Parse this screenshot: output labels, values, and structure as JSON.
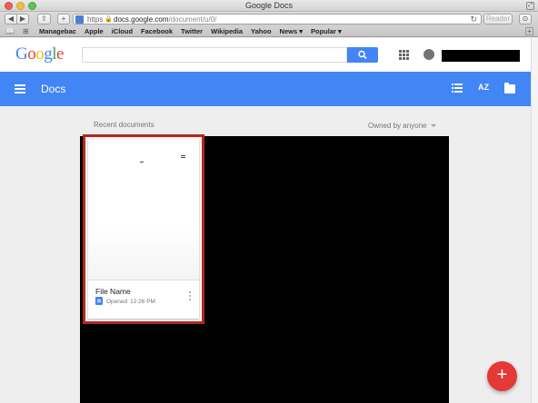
{
  "window": {
    "title": "Google Docs"
  },
  "browser": {
    "url_scheme": "https",
    "url_host": "docs.google.com",
    "url_path": "/document/u/0/",
    "reader_label": "Reader"
  },
  "bookmarks": [
    "Managebac",
    "Apple",
    "iCloud",
    "Facebook",
    "Twitter",
    "Wikipedia",
    "Yahoo",
    "News ▾",
    "Popular ▾"
  ],
  "google": {
    "logo": [
      "G",
      "o",
      "o",
      "g",
      "l",
      "e"
    ],
    "logo_colors": [
      "#4285f4",
      "#ea4335",
      "#fbbc05",
      "#4285f4",
      "#34a853",
      "#ea4335"
    ]
  },
  "appbar": {
    "title": "Docs",
    "sort_label": "AZ"
  },
  "content": {
    "section_label": "Recent documents",
    "owner_filter": "Owned by anyone",
    "document": {
      "name": "File Name",
      "status": "Opened",
      "time": "12:26 PM"
    }
  },
  "fab": {
    "label": "+"
  },
  "colors": {
    "accent": "#4285f4",
    "highlight": "#b3271e",
    "fab": "#e53935"
  }
}
